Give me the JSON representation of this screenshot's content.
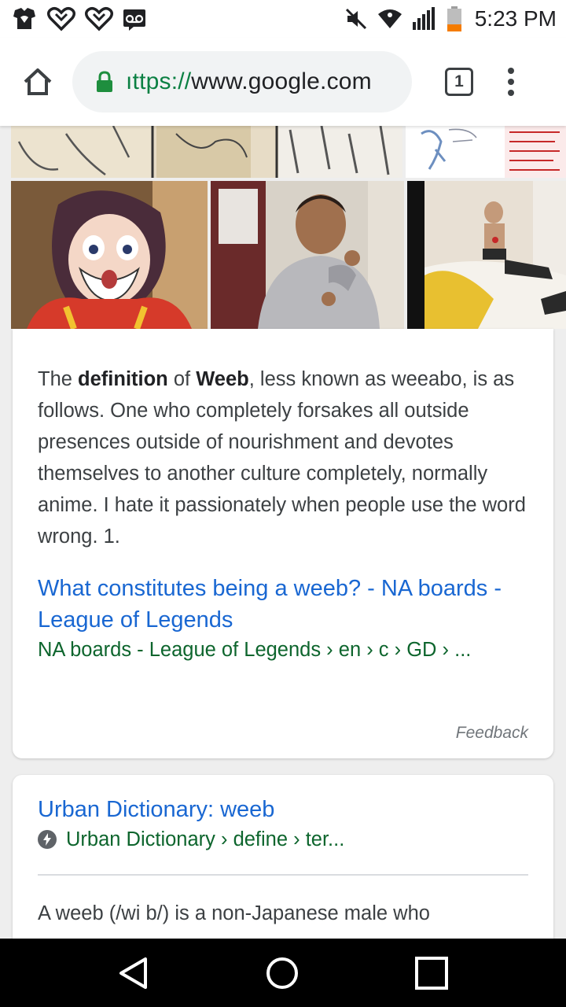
{
  "status_bar": {
    "time": "5:23 PM",
    "left_icons": [
      "app-icon",
      "brand-heart-icon",
      "brand-heart-icon",
      "voicemail-icon"
    ],
    "right_icons": [
      "mute-icon",
      "wifi-icon",
      "signal-icon",
      "battery-icon"
    ],
    "battery_color": "#f57c00"
  },
  "browser": {
    "url_scheme": "https://",
    "url_host": "www.google.com",
    "url_visible_prefix": "ıttps://",
    "tab_count": "1",
    "secure_color": "#1e8e3e"
  },
  "snippet": {
    "t1": "The ",
    "b1": "definition",
    "t2": " of ",
    "b2": "Weeb",
    "t3": ", less known as weeabo, is as follows. One who completely forsakes all outside presences outside of nourishment and devotes themselves to another culture completely, normally anime. I hate it passionately when people use the word wrong. 1."
  },
  "result1": {
    "title": "What constitutes being a weeb? - NA boards - League of Legends",
    "url": "NA boards - League of Legends › en › c › GD › ..."
  },
  "feedback_label": "Feedback",
  "result2": {
    "title": "Urban Dictionary: weeb",
    "url": "Urban Dictionary › define › ter...",
    "snippet": "A weeb (/wi b/) is a non-Japanese male who"
  },
  "nav": {
    "back": "back-icon",
    "home": "home-icon",
    "recents": "recents-icon"
  },
  "colors": {
    "link": "#1967d2",
    "url_green": "#0d652d"
  }
}
